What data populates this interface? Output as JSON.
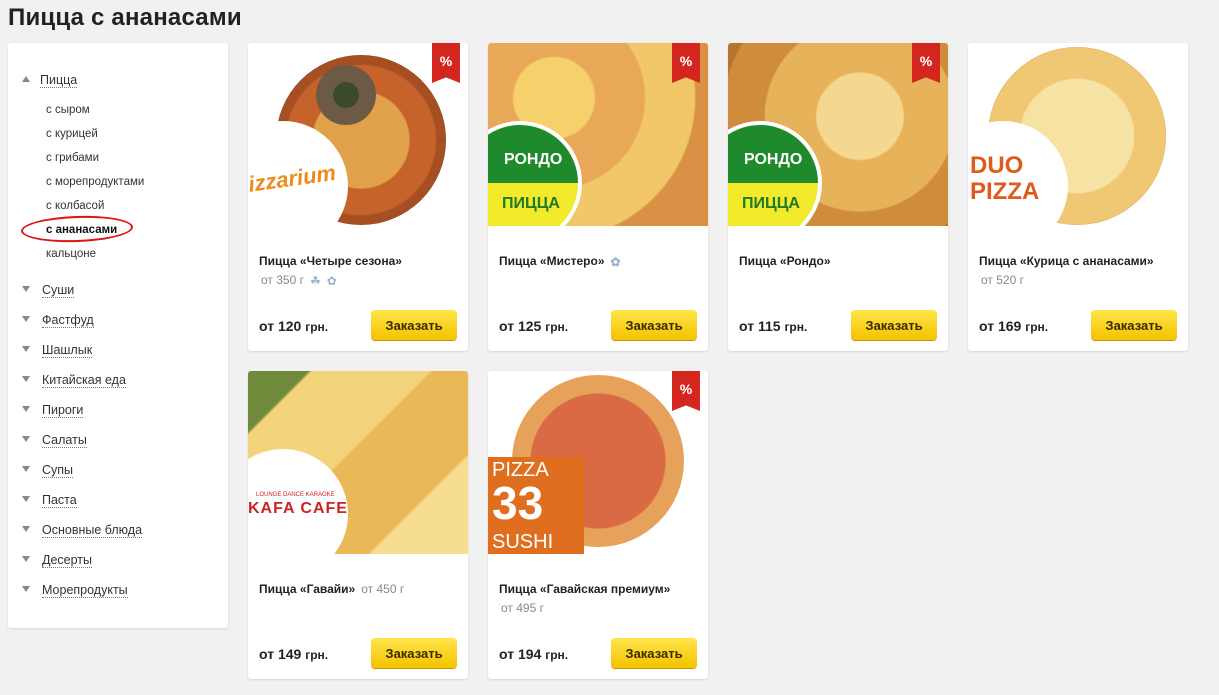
{
  "page_title": "Пицца с ананасами",
  "sidebar": {
    "open_category": "Пицца",
    "subcategories": [
      "с сыром",
      "с курицей",
      "с грибами",
      "с морепродуктами",
      "с колбасой",
      "с ананасами",
      "кальцоне"
    ],
    "active_subcategory": "с ананасами",
    "categories": [
      "Суши",
      "Фастфуд",
      "Шашлык",
      "Китайская еда",
      "Пироги",
      "Салаты",
      "Супы",
      "Паста",
      "Основные блюда",
      "Десерты",
      "Морепродукты"
    ]
  },
  "discount_badge": "%",
  "order_label": "Заказать",
  "currency": "грн.",
  "products": [
    {
      "name": "Пицца «Четыре сезона»",
      "weight": "от 350 г",
      "icons": [
        "garlic-icon",
        "fish-icon"
      ],
      "price": "от 120",
      "discount": true,
      "logo": "Pizzarium"
    },
    {
      "name": "Пицца «Мистеро»",
      "weight": "",
      "icons": [
        "fish-icon"
      ],
      "price": "от 125",
      "discount": true,
      "logo": "РОНДО ПИЦЦА"
    },
    {
      "name": "Пицца «Рондо»",
      "weight": "",
      "icons": [],
      "price": "от 115",
      "discount": true,
      "logo": "РОНДО ПИЦЦА"
    },
    {
      "name": "Пицца «Курица с ананасами»",
      "weight": "от 520 г",
      "icons": [],
      "price": "от 169",
      "discount": false,
      "logo": "DUO PIZZA"
    },
    {
      "name": "Пицца «Гавайи»",
      "weight": "от 450 г",
      "icons": [],
      "price": "от 149",
      "discount": false,
      "logo": "KAFA CAFE"
    },
    {
      "name": "Пицца «Гавайская премиум»",
      "weight": "от 495 г",
      "icons": [],
      "price": "от 194",
      "discount": true,
      "logo": "PIZZA 33 SUSHI"
    }
  ],
  "logo_text": {
    "pizzarium": "izzarium",
    "rondo_top": "РОНДО",
    "rondo_bottom": "ПИЦЦА",
    "duo_top": "DUO",
    "duo_bottom": "PIZZA",
    "kafa_small": "LOUNGE DANCE KARAOKE",
    "kafa": "KAFA CAFE",
    "p33_top": "PIZZA",
    "p33_num": "33",
    "p33_bottom": "SUSHI"
  }
}
